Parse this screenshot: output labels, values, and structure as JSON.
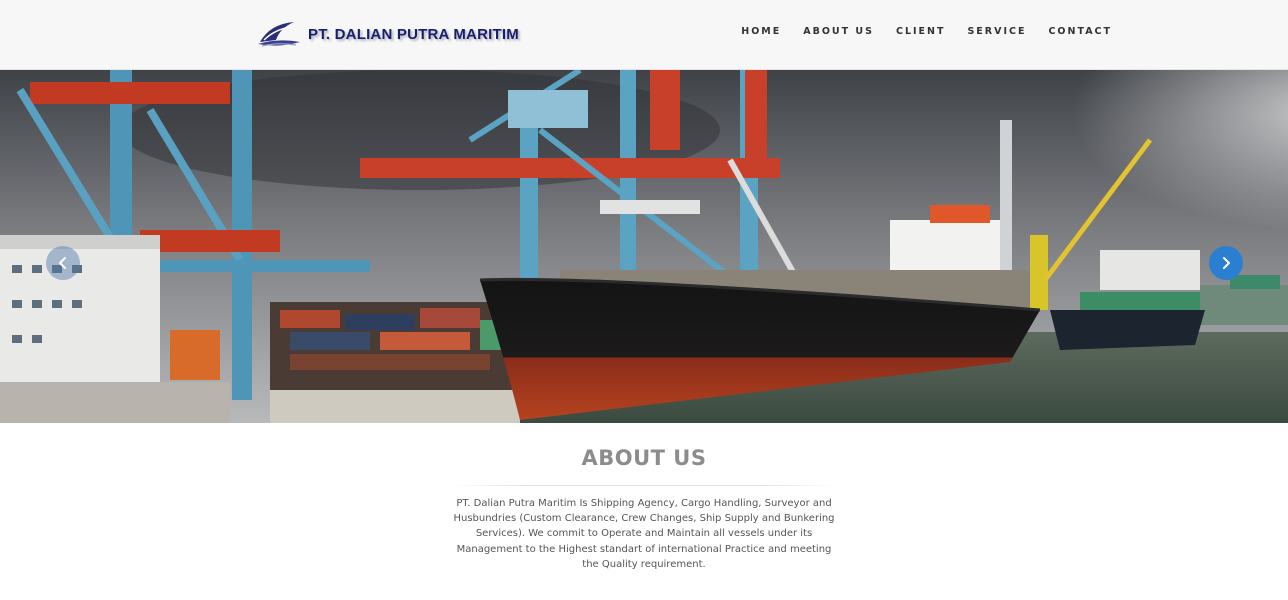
{
  "header": {
    "brand": "PT. DALIAN PUTRA MARITIM",
    "logo_icon": "ship-bow-icon",
    "nav": [
      {
        "label": "HOME"
      },
      {
        "label": "ABOUT US"
      },
      {
        "label": "CLIENT"
      },
      {
        "label": "SERVICE"
      },
      {
        "label": "CONTACT"
      }
    ]
  },
  "hero": {
    "prev_icon": "chevron-left-icon",
    "next_icon": "chevron-right-icon",
    "accent_color": "#2a7fd0"
  },
  "about": {
    "title": "ABOUT US",
    "body": "PT. Dalian Putra Maritim Is Shipping Agency, Cargo Handling, Surveyor and Husbundries (Custom Clearance, Crew Changes, Ship Supply and Bunkering Services). We commit to Operate and Maintain all vessels under its Management to the Highest standart of international Practice and meeting the Quality requirement."
  }
}
